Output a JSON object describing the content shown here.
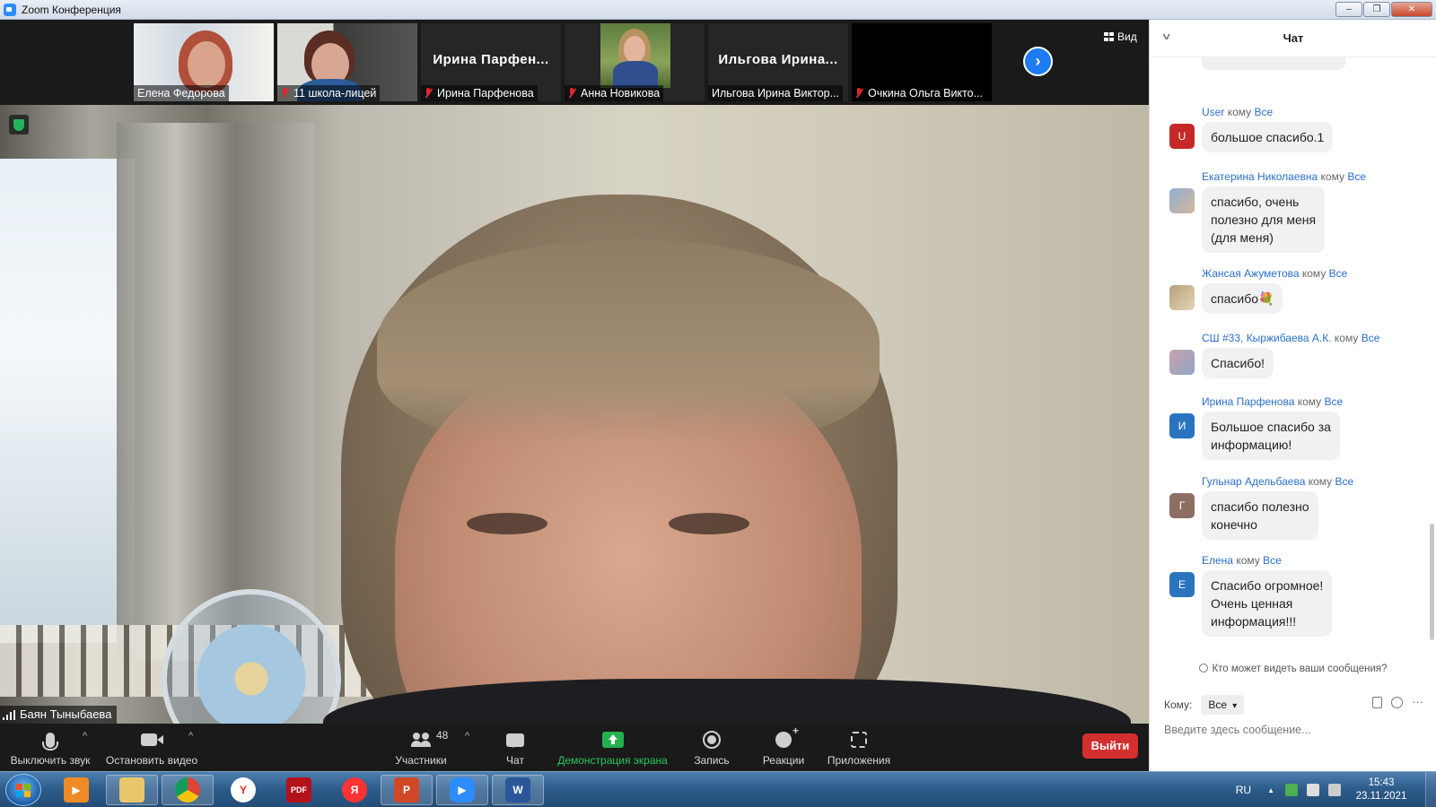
{
  "window": {
    "title": "Zoom Конференция",
    "controls": [
      "–",
      "❐",
      "✕"
    ]
  },
  "gallery": {
    "view_label": "Вид",
    "next_icon": "chevron-right-icon",
    "participants": [
      {
        "name": "Елена Федорова",
        "muted": false,
        "video": true
      },
      {
        "name": "11 школа-лицей",
        "muted": true,
        "video": true
      },
      {
        "name": "Ирина Парфенова",
        "display": "Ирина  Парфен...",
        "muted": true,
        "video": false
      },
      {
        "name": "Анна Новикова",
        "muted": true,
        "video": true
      },
      {
        "name": "Ильгова Ирина Виктор...",
        "display": "Ильгова  Ирина...",
        "muted": false,
        "video": false
      },
      {
        "name": "Очкина Ольга Викто...",
        "muted": true,
        "video": false
      }
    ]
  },
  "main_speaker": {
    "name": "Баян Тыныбаева",
    "encryption_icon": "shield-check-icon"
  },
  "toolbar": {
    "mute_label": "Выключить звук",
    "video_label": "Остановить видео",
    "participants_label": "Участники",
    "participants_count": "48",
    "chat_label": "Чат",
    "share_label": "Демонстрация экрана",
    "record_label": "Запись",
    "reactions_label": "Реакции",
    "apps_label": "Приложения",
    "leave_label": "Выйти",
    "accent_color": "#28c75a",
    "leave_color": "#d32f2f"
  },
  "chat": {
    "title": "Чат",
    "to_word": "кому",
    "messages": [
      {
        "sender": "User",
        "to": "Все",
        "avatar": "U",
        "avatar_color": "#c62828",
        "text": "большое спасибо.1"
      },
      {
        "sender": "Екатерина Николаевна",
        "to": "Все",
        "avatar": "",
        "avatar_color": "#8fb0d4",
        "text": "спасибо, очень\nполезно для меня\n(для меня)"
      },
      {
        "sender": "Жансая Ажуметова",
        "to": "Все",
        "avatar": "",
        "avatar_color": "#b8a078",
        "text": "спасибо💐"
      },
      {
        "sender": "СШ #33, Кыржибаева А.К.",
        "to": "Все",
        "avatar": "",
        "avatar_color": "#c9a3b0",
        "text": "Спасибо!"
      },
      {
        "sender": "Ирина Парфенова",
        "to": "Все",
        "avatar": "И",
        "avatar_color": "#2a74bf",
        "text": "Большое спасибо за\nинформацию!"
      },
      {
        "sender": "Гульнар Адельбаева",
        "to": "Все",
        "avatar": "Г",
        "avatar_color": "#8d6e63",
        "text": "спасибо  полезно\nконечно"
      },
      {
        "sender": "Елена",
        "to": "Все",
        "avatar": "Е",
        "avatar_color": "#2a74bf",
        "text": "Спасибо огромное!\nОчень ценная\nинформация!!!"
      }
    ],
    "who_can_see": "Кто может видеть ваши сообщения?",
    "recipient_label": "Кому:",
    "recipient_value": "Все",
    "input_placeholder": "Введите здесь сообщение..."
  },
  "taskbar": {
    "apps": [
      "media-player",
      "file-explorer",
      "chrome",
      "yandex-browser",
      "pdf-reader",
      "yandex",
      "powerpoint",
      "zoom",
      "word"
    ],
    "language": "RU",
    "time": "15:43",
    "date": "23.11.2021"
  }
}
